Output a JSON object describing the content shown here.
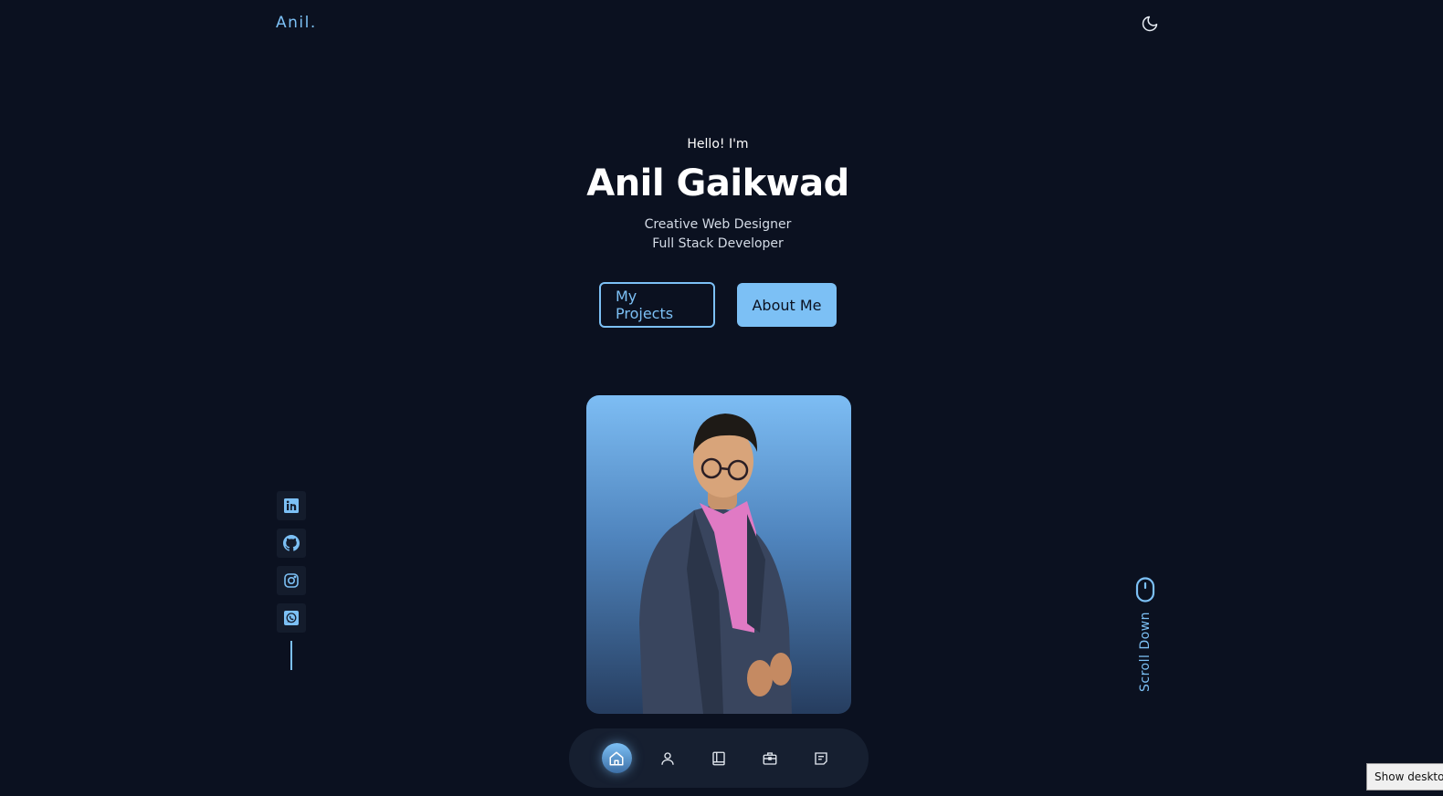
{
  "header": {
    "logo": "Anil.",
    "theme_icon": "moon-icon"
  },
  "hero": {
    "greeting": "Hello! I'm",
    "name": "Anil Gaikwad",
    "roles": [
      "Creative Web Designer",
      "Full Stack Developer"
    ],
    "buttons": {
      "projects": "My Projects",
      "about": "About Me"
    }
  },
  "social": [
    "linkedin-icon",
    "github-icon",
    "instagram-icon",
    "whatsapp-icon"
  ],
  "scroll": {
    "label": "Scroll Down",
    "icon": "mouse-icon"
  },
  "bottom_nav": {
    "items": [
      "home-icon",
      "user-icon",
      "book-icon",
      "briefcase-icon",
      "message-icon"
    ],
    "active": "home-icon"
  },
  "taskbar_tooltip": "Show desktop",
  "colors": {
    "background": "#0b1120",
    "accent": "#7cc0f5",
    "panel": "#161f30"
  }
}
